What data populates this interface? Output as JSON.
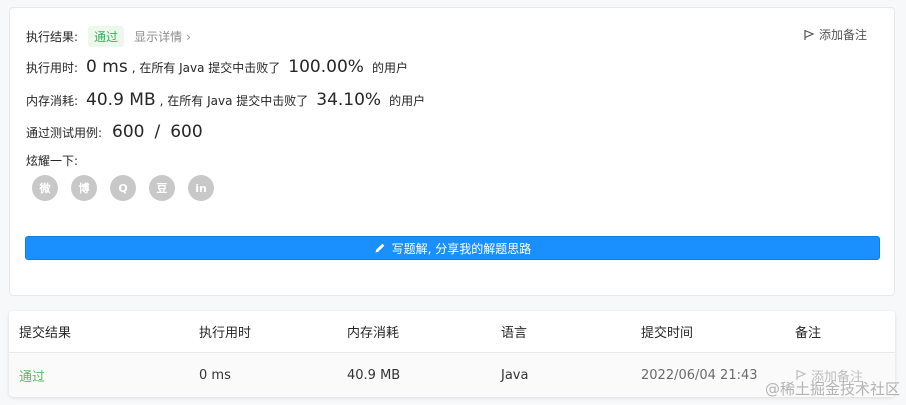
{
  "result": {
    "label": "执行结果:",
    "status": "通过",
    "detail_link": "显示详情",
    "detail_chevron": "›",
    "add_note": "添加备注"
  },
  "runtime": {
    "label": "执行用时:",
    "value": "0 ms",
    "prefix": ", 在所有 Java 提交中击败了",
    "percent": "100.00%",
    "suffix": "的用户"
  },
  "memory": {
    "label": "内存消耗:",
    "value": "40.9 MB",
    "prefix": ", 在所有 Java 提交中击败了",
    "percent": "34.10%",
    "suffix": "的用户"
  },
  "tests": {
    "label": "通过测试用例:",
    "passed": "600",
    "separator": "/",
    "total": "600"
  },
  "share": {
    "label": "炫耀一下:",
    "icons": [
      {
        "name": "wechat-icon",
        "glyph": "微"
      },
      {
        "name": "weibo-icon",
        "glyph": "博"
      },
      {
        "name": "qq-icon",
        "glyph": "Q"
      },
      {
        "name": "douban-icon",
        "glyph": "豆"
      },
      {
        "name": "linkedin-icon",
        "glyph": "in"
      }
    ]
  },
  "solution_button": "写题解, 分享我的解题思路",
  "table": {
    "headers": [
      "提交结果",
      "执行用时",
      "内存消耗",
      "语言",
      "提交时间",
      "备注"
    ],
    "row": {
      "result": "通过",
      "runtime": "0 ms",
      "memory": "40.9 MB",
      "language": "Java",
      "submitted_at": "2022/06/04 21:43",
      "note": "添加备注"
    }
  },
  "watermark": "@稀土掘金技术社区",
  "colors": {
    "accent": "#1a90ff",
    "success": "#2db55d",
    "muted_icon": "#c8c8c8"
  }
}
